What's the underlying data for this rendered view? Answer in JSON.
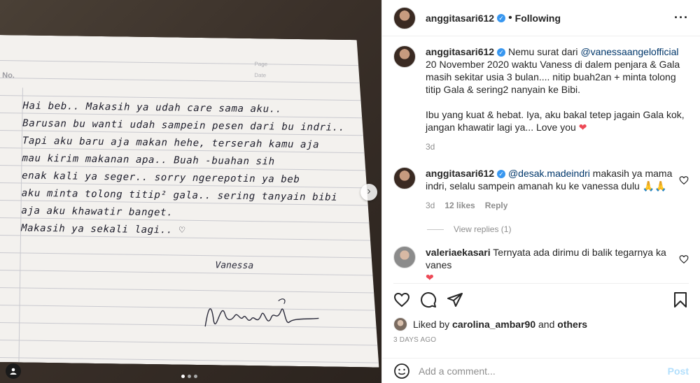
{
  "post": {
    "photo": {
      "paper_no": "No.",
      "paper_page": "Page",
      "paper_date": "Date",
      "letter_lines": [
        "Hai beb.. Makasih ya udah care sama aku..",
        "Barusan bu wanti udah sampein pesen dari bu indri..",
        "Tapi aku baru aja makan hehe, terserah kamu aja",
        "mau kirim makanan apa.. Buah -buahan sih",
        "enak kali ya seger.. sorry ngerepotin ya beb",
        "aku minta tolong titip² gala.. sering tanyain bibi",
        "aja aku khawatir banget.",
        "Makasih ya sekali lagi.. ♡"
      ],
      "signature_name": "Vanessa",
      "carousel_dots": 3,
      "carousel_active_index": 0
    },
    "header": {
      "username": "anggitasari612",
      "separator": "•",
      "follow_status": "Following",
      "more_icon": "more-horizontal-icon"
    },
    "caption": {
      "username": "anggitasari612",
      "text_prefix": "Nemu surat dari ",
      "mention": "@vanessaangelofficial",
      "text_suffix": " 20 November 2020 waktu Vaness di dalem penjara & Gala masih sekitar usia 3 bulan.... nitip buah2an + minta tolong titip Gala & sering2 nanyain ke Bibi.",
      "text_2": "Ibu yang kuat & hebat. Iya, aku bakal tetep jagain Gala kok, jangan khawatir lagi ya... Love you",
      "emoji": "❤",
      "time": "3d"
    },
    "comments": [
      {
        "username": "anggitasari612",
        "mention": "@desak.madeindri",
        "text": " makasih ya mama indri, selalu sampein amanah ku ke vanessa dulu 🙏🙏",
        "time": "3d",
        "likes": "12 likes",
        "reply": "Reply",
        "view_replies": "View replies (1)"
      },
      {
        "username": "valeriaekasari",
        "text": " Ternyata ada dirimu di balik tegarnya ka vanes",
        "emoji": "❤"
      }
    ],
    "likes": {
      "prefix": "Liked by ",
      "user": "carolina_ambar90",
      "middle": " and ",
      "others": "others"
    },
    "timeago": "3 DAYS AGO",
    "add_comment": {
      "placeholder": "Add a comment...",
      "post_label": "Post"
    },
    "colors": {
      "link": "#00376b",
      "verified": "#3897f0",
      "heart": "#ed4956",
      "post_disabled": "#b2dffc"
    }
  }
}
